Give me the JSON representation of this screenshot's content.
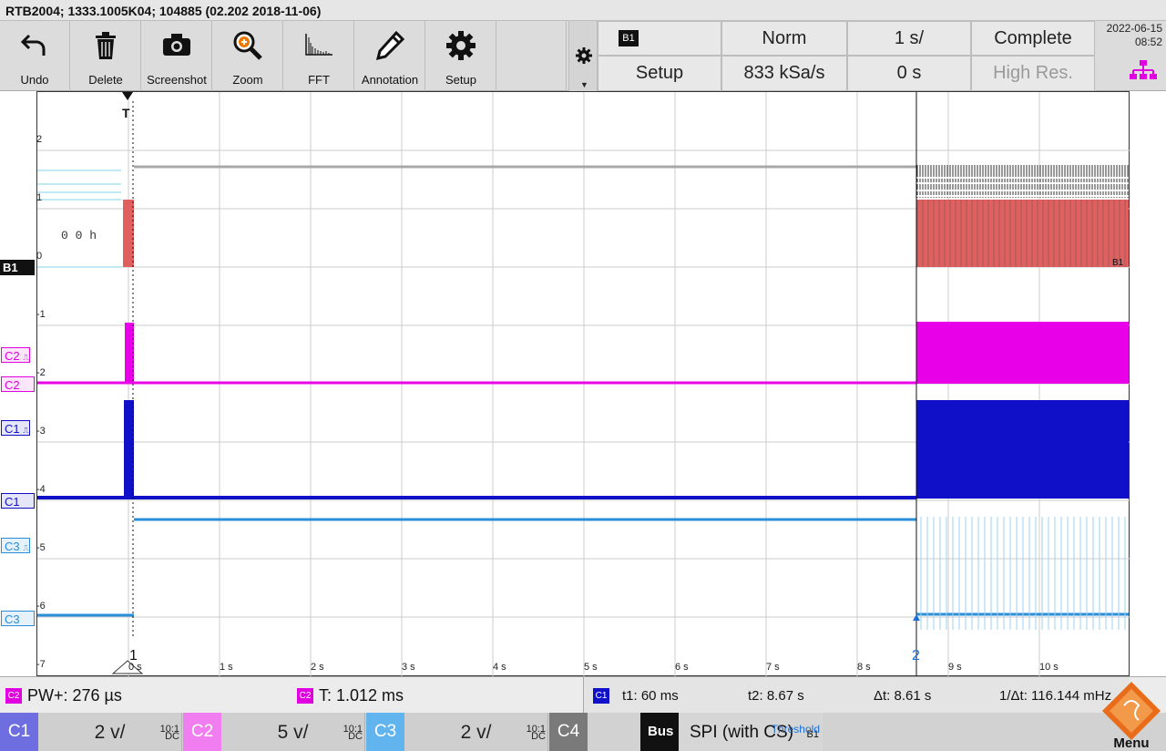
{
  "title": "RTB2004; 1333.1005K04; 104885 (02.202 2018-11-06)",
  "toolbar": {
    "undo": "Undo",
    "delete": "Delete",
    "screenshot": "Screenshot",
    "zoom": "Zoom",
    "fft": "FFT",
    "annotation": "Annotation",
    "setup": "Setup"
  },
  "status": {
    "source_tag": "B1",
    "trigger_mode": "Norm",
    "time_scale": "1 s/",
    "acquisition": "Complete",
    "setup": "Setup",
    "sample_rate": "833 kSa/s",
    "position": "0 s",
    "high_res": "High Res.",
    "date": "2022-06-15",
    "time": "08:52"
  },
  "axis": {
    "y_labels": [
      "2",
      "1",
      "0",
      "-1",
      "-2",
      "-3",
      "-4",
      "-5",
      "-6",
      "-7"
    ],
    "x_labels": [
      "0 s",
      "1 s",
      "2 s",
      "3 s",
      "4 s",
      "5 s",
      "6 s",
      "7 s",
      "8 s",
      "9 s",
      "10 s"
    ]
  },
  "markers": {
    "trigger": "T",
    "cursor1": "1",
    "cursor2": "2",
    "bus_value": "0 0 h",
    "bus_end": "B1"
  },
  "channels_left": {
    "b1": "B1",
    "c2_level": "C2",
    "c2": "C2",
    "c1_level": "C1",
    "c1": "C1",
    "c3_level": "C3",
    "c3": "C3"
  },
  "measurements": {
    "m1_tag": "C2",
    "m1": "PW+: 276 µs",
    "m2_tag": "C2",
    "m2": "T: 1.012 ms",
    "cursor_tag": "C1",
    "t1": "t1: 60 ms",
    "t2": "t2: 8.67 s",
    "dt": "Δt: 8.61 s",
    "inv_dt": "1/Δt: 116.144 mHz"
  },
  "channel_bar": {
    "c1": {
      "name": "C1",
      "vdiv": "2 v/",
      "coupling": "DC",
      "probe": "10:1"
    },
    "c2": {
      "name": "C2",
      "vdiv": "5 v/",
      "coupling": "DC",
      "probe": "10:1"
    },
    "c3": {
      "name": "C3",
      "vdiv": "2 v/",
      "coupling": "DC",
      "probe": "10:1"
    },
    "c4": {
      "name": "C4"
    },
    "bus": {
      "label": "Bus",
      "value": "SPI (with CS)",
      "source": "B1",
      "threshold": "Threshold"
    },
    "menu": "Menu"
  },
  "colors": {
    "c1": "#1010c8",
    "c2": "#e800e8",
    "c3": "#2a8ed8",
    "bus": "#e06060",
    "grid": "#cccccc"
  }
}
